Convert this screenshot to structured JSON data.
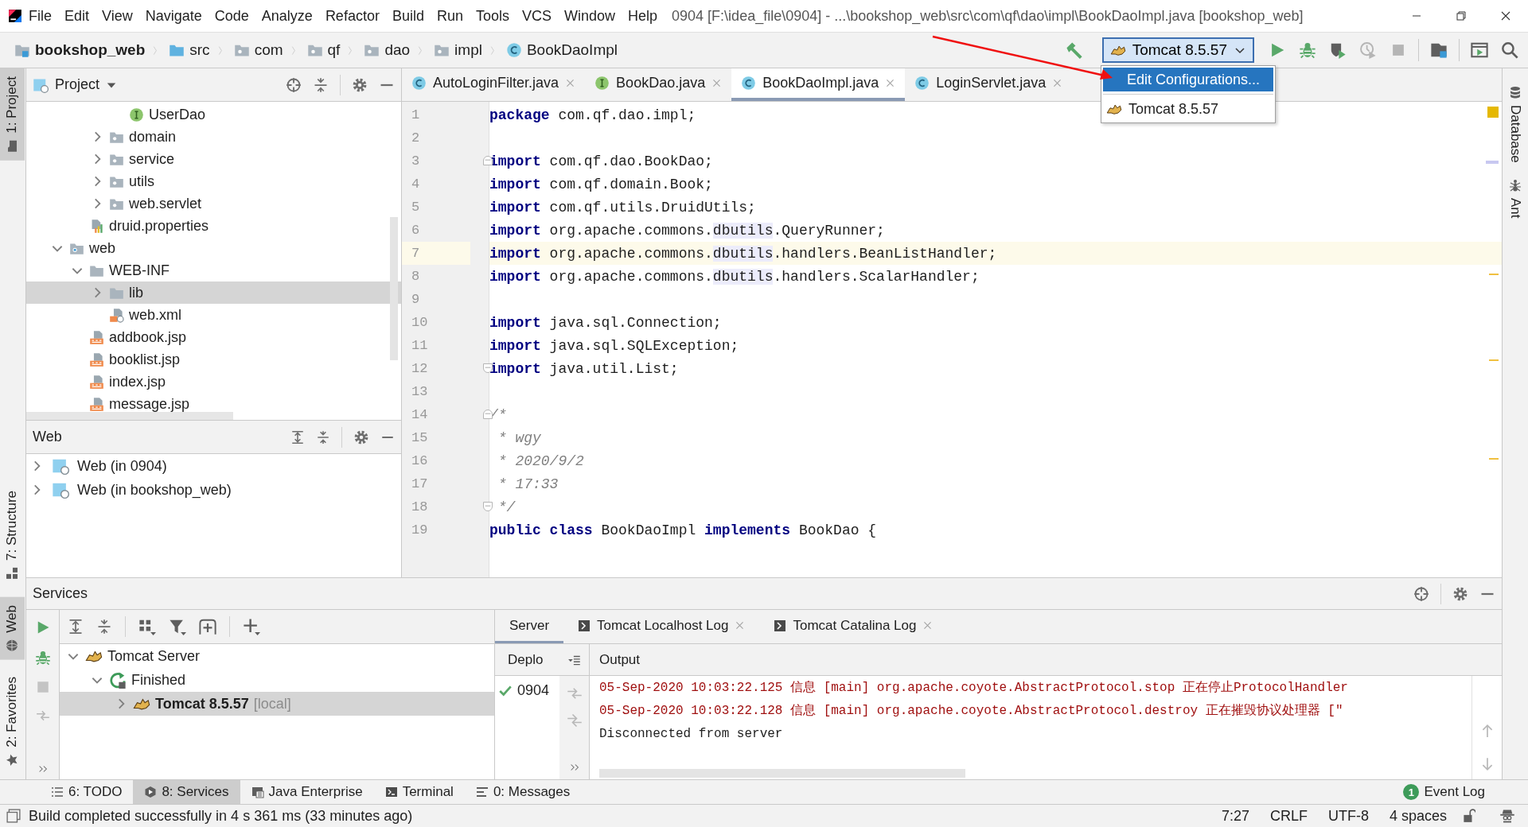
{
  "window": {
    "title": "0904 [F:\\idea_file\\0904] - ...\\bookshop_web\\src\\com\\qf\\dao\\impl\\BookDaoImpl.java [bookshop_web]"
  },
  "menu": [
    "File",
    "Edit",
    "View",
    "Navigate",
    "Code",
    "Analyze",
    "Refactor",
    "Build",
    "Run",
    "Tools",
    "VCS",
    "Window",
    "Help"
  ],
  "breadcrumbs": [
    {
      "label": "bookshop_web",
      "kind": "module"
    },
    {
      "label": "src",
      "kind": "source"
    },
    {
      "label": "com",
      "kind": "package"
    },
    {
      "label": "qf",
      "kind": "package"
    },
    {
      "label": "dao",
      "kind": "package"
    },
    {
      "label": "impl",
      "kind": "package"
    },
    {
      "label": "BookDaoImpl",
      "kind": "class"
    }
  ],
  "run_config": {
    "label": "Tomcat 8.5.57",
    "expanded": true
  },
  "run_menu": [
    {
      "label": "Edit Configurations...",
      "kind": "action",
      "selected": true
    },
    {
      "label": "Tomcat 8.5.57",
      "kind": "config",
      "selected": false
    }
  ],
  "left_stripe": {
    "top": [
      {
        "label": "1: Project",
        "kind": "project",
        "selected": true
      }
    ],
    "bottom": [
      {
        "label": "7: Structure",
        "kind": "structure",
        "selected": false
      },
      {
        "label": "Web",
        "kind": "web",
        "selected": true
      },
      {
        "label": "2: Favorites",
        "kind": "favorites",
        "selected": false
      }
    ]
  },
  "right_stripe": [
    {
      "label": "Database",
      "kind": "database"
    },
    {
      "label": "Ant",
      "kind": "ant"
    }
  ],
  "project": {
    "title": "Project",
    "tree": [
      {
        "children": [
          {
            "children": [
              {
                "children": [
                  {
                    "label": "UserDao",
                    "kind": "interface",
                    "selected": false
                  }
                ]
              },
              {
                "label": "domain",
                "kind": "package",
                "expanded": false,
                "selected": false
              },
              {
                "label": "service",
                "kind": "package",
                "expanded": false,
                "selected": false
              },
              {
                "label": "utils",
                "kind": "package",
                "expanded": false,
                "selected": false
              },
              {
                "label": "web.servlet",
                "kind": "package",
                "expanded": false,
                "selected": false
              }
            ]
          },
          {
            "label": "druid.properties",
            "kind": "properties",
            "selected": false
          }
        ]
      },
      {
        "label": "web",
        "kind": "webfolder",
        "expanded": true,
        "selected": false,
        "children": [
          {
            "label": "WEB-INF",
            "kind": "folder",
            "expanded": true,
            "selected": false,
            "children": [
              {
                "label": "lib",
                "kind": "folder",
                "expanded": false,
                "selected": true
              },
              {
                "label": "web.xml",
                "kind": "xml",
                "selected": false
              }
            ]
          },
          {
            "label": "addbook.jsp",
            "kind": "jsp",
            "selected": false
          },
          {
            "label": "booklist.jsp",
            "kind": "jsp",
            "selected": false
          },
          {
            "label": "index.jsp",
            "kind": "jsp",
            "selected": false
          },
          {
            "label": "message.jsp",
            "kind": "jsp",
            "selected": false
          }
        ]
      }
    ]
  },
  "web_panel": {
    "title": "Web",
    "items": [
      {
        "label": "Web (in 0904)",
        "expanded": false
      },
      {
        "label": "Web (in bookshop_web)",
        "expanded": false
      }
    ]
  },
  "editor": {
    "tabs": [
      {
        "label": "AutoLoginFilter.java",
        "kind": "class",
        "selected": false
      },
      {
        "label": "BookDao.java",
        "kind": "interface",
        "selected": false
      },
      {
        "label": "BookDaoImpl.java",
        "kind": "class",
        "selected": true
      },
      {
        "label": "LoginServlet.java",
        "kind": "class",
        "selected": false
      }
    ],
    "lines": [
      {
        "number": "1",
        "current": false,
        "tokens": [
          {
            "kind": "keyword",
            "text": "package"
          },
          {
            "kind": "plain",
            "text": " com.qf.dao.impl;"
          }
        ]
      },
      {
        "number": "2",
        "current": false
      },
      {
        "number": "3",
        "current": false,
        "fold_start": true,
        "tokens": [
          {
            "kind": "keyword",
            "text": "import"
          },
          {
            "kind": "plain",
            "text": " com.qf.dao.BookDao;"
          }
        ]
      },
      {
        "number": "4",
        "current": false,
        "tokens": [
          {
            "kind": "keyword",
            "text": "import"
          },
          {
            "kind": "plain",
            "text": " com.qf.domain.Book;"
          }
        ]
      },
      {
        "number": "5",
        "current": false,
        "tokens": [
          {
            "kind": "keyword",
            "text": "import"
          },
          {
            "kind": "plain",
            "text": " com.qf.utils.DruidUtils;"
          }
        ]
      },
      {
        "number": "6",
        "current": false,
        "tokens": [
          {
            "kind": "keyword",
            "text": "import"
          },
          {
            "kind": "plain",
            "text": " org.apache.commons."
          },
          {
            "kind": "highlight",
            "text": "dbutils"
          },
          {
            "kind": "plain",
            "text": ".QueryRunner;"
          }
        ]
      },
      {
        "number": "7",
        "current": true,
        "tokens": [
          {
            "kind": "keyword",
            "text": "import"
          },
          {
            "kind": "plain",
            "text": " org.apache.commons."
          },
          {
            "kind": "highlight",
            "text": "dbutils"
          },
          {
            "kind": "plain",
            "text": ".handlers.BeanListHandler;"
          }
        ]
      },
      {
        "number": "8",
        "current": false,
        "tokens": [
          {
            "kind": "keyword",
            "text": "import"
          },
          {
            "kind": "plain",
            "text": " org.apache.commons."
          },
          {
            "kind": "highlight",
            "text": "dbutils"
          },
          {
            "kind": "plain",
            "text": ".handlers.ScalarHandler;"
          }
        ]
      },
      {
        "number": "9",
        "current": false
      },
      {
        "number": "10",
        "current": false,
        "tokens": [
          {
            "kind": "keyword",
            "text": "import"
          },
          {
            "kind": "plain",
            "text": " java.sql.Connection;"
          }
        ]
      },
      {
        "number": "11",
        "current": false,
        "tokens": [
          {
            "kind": "keyword",
            "text": "import"
          },
          {
            "kind": "plain",
            "text": " java.sql.SQLException;"
          }
        ]
      },
      {
        "number": "12",
        "current": false,
        "fold_end": true,
        "tokens": [
          {
            "kind": "keyword",
            "text": "import"
          },
          {
            "kind": "plain",
            "text": " java.util.List;"
          }
        ]
      },
      {
        "number": "13",
        "current": false
      },
      {
        "number": "14",
        "current": false,
        "fold_start": true,
        "tokens": [
          {
            "kind": "comment",
            "text": "/*"
          }
        ]
      },
      {
        "number": "15",
        "current": false,
        "tokens": [
          {
            "kind": "comment",
            "text": " * wgy"
          }
        ]
      },
      {
        "number": "16",
        "current": false,
        "tokens": [
          {
            "kind": "comment",
            "text": " * 2020/9/2"
          }
        ]
      },
      {
        "number": "17",
        "current": false,
        "tokens": [
          {
            "kind": "comment",
            "text": " * 17:33"
          }
        ]
      },
      {
        "number": "18",
        "current": false,
        "fold_end": true,
        "tokens": [
          {
            "kind": "comment",
            "text": " */"
          }
        ]
      },
      {
        "number": "19",
        "current": false,
        "tokens": [
          {
            "kind": "keyword",
            "text": "public class"
          },
          {
            "kind": "plain",
            "text": " BookDaoImpl "
          },
          {
            "kind": "keyword",
            "text": "implements"
          },
          {
            "kind": "plain",
            "text": " BookDao {"
          }
        ]
      }
    ]
  },
  "services": {
    "title": "Services",
    "tree": [
      {
        "label": "Tomcat Server",
        "kind": "server",
        "expanded": true,
        "selected": false,
        "children": [
          {
            "label": "Finished",
            "kind": "status",
            "expanded": true,
            "selected": false,
            "children": [
              {
                "label": "Tomcat 8.5.57",
                "detail": "[local]",
                "kind": "instance",
                "expanded": false,
                "selected": true
              }
            ]
          }
        ]
      }
    ],
    "tabs": [
      {
        "label": "Server",
        "kind": "plain",
        "selected": true,
        "closable": false
      },
      {
        "label": "Tomcat Localhost Log",
        "kind": "log",
        "selected": false,
        "closable": true
      },
      {
        "label": "Tomcat Catalina Log",
        "kind": "log",
        "selected": false,
        "closable": true
      }
    ],
    "deploy_header": "Deplo",
    "output_header": "Output",
    "deployments": [
      {
        "label": "0904",
        "ok": true
      }
    ],
    "output": [
      {
        "kind": "error",
        "text": "05-Sep-2020 10:03:22.125 信息 [main] org.apache.coyote.AbstractProtocol.stop 正在停止ProtocolHandler"
      },
      {
        "kind": "error",
        "text": "05-Sep-2020 10:03:22.128 信息 [main] org.apache.coyote.AbstractProtocol.destroy 正在摧毁协议处理器 [\""
      },
      {
        "kind": "plain",
        "text": "Disconnected from server"
      }
    ]
  },
  "tool_buttons": {
    "left": [
      {
        "label": "6: TODO",
        "kind": "todo",
        "selected": false
      },
      {
        "label": "8: Services",
        "kind": "services",
        "selected": true
      },
      {
        "label": "Java Enterprise",
        "kind": "enterprise",
        "selected": false
      },
      {
        "label": "Terminal",
        "kind": "terminal",
        "selected": false
      },
      {
        "label": "0: Messages",
        "kind": "messages",
        "selected": false
      }
    ],
    "right": [
      {
        "label": "Event Log",
        "selected": false,
        "badge": "1"
      }
    ]
  },
  "status_bar": {
    "message": "Build completed successfully in 4 s 361 ms (33 minutes ago)",
    "items": [
      "7:27",
      "CRLF",
      "UTF-8",
      "4 spaces"
    ]
  }
}
